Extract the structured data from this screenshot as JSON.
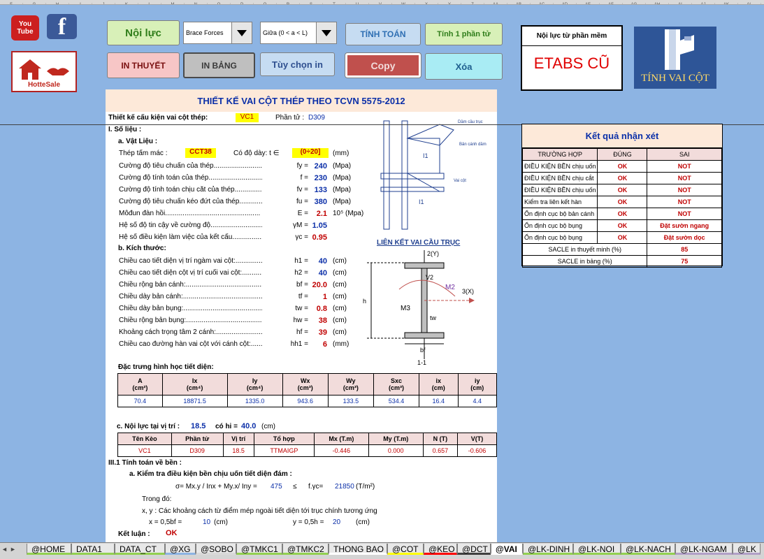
{
  "columns": [
    "F",
    "G",
    "H",
    "I",
    "J",
    "K",
    "L",
    "M",
    "N",
    "O",
    "P",
    "Q",
    "R",
    "S",
    "T",
    "U",
    "V",
    "W",
    "X",
    "Y",
    "Z",
    "AA",
    "AB",
    "AC",
    "AD",
    "AE",
    "AF",
    "AG",
    "AH",
    "AI",
    "AJ",
    "AK",
    "AL"
  ],
  "social": {
    "youtube": "You Tube",
    "facebook": "f",
    "hotte": "HotteSale"
  },
  "toolbar": {
    "noi_luc": "Nội lực",
    "brace": "Brace Forces",
    "position": "Giữa (0 < a < L)",
    "tinh_toan": "TÍNH TOÁN",
    "tinh_1": "Tính 1 phần tử",
    "in_thuyet": "IN THUYẾT",
    "in_bang": "IN BẢNG",
    "tuy_chon": "Tùy chọn in",
    "copy": "Copy",
    "xoa": "Xóa",
    "noi_luc_phan_mem": "Nội lực từ phần mềm",
    "etabs": "ETABS CŨ",
    "tinh_vai_cot": "TÍNH VAI CỘT"
  },
  "colors": {
    "accent_red": "#c00000",
    "value_blue": "#0b2fa8",
    "header_peach": "#fde9d9",
    "input_yellow": "#ffff00"
  },
  "sheet": {
    "title": "THIẾT KẾ VAI CỘT THÉP THEO TCVN 5575-2012",
    "design_label": "Thiết kế cấu kiện vai cột thép:",
    "design_value": "VC1",
    "element_label": "Phần tử :",
    "element_value": "D309",
    "sec1": "I.  Số liệu :",
    "sec_a": "a. Vật Liệu :",
    "steel_label": "Thép tấm mác :",
    "steel_value": "CCT38",
    "thick_label": "Có độ dày:  t ∈",
    "thick_value": "(0÷20]",
    "thick_unit": "(mm)",
    "materials": [
      {
        "label": "Cường độ tiêu chuẩn của thép.............................",
        "sym": "fy =",
        "val": "240",
        "unit": "(Mpa)"
      },
      {
        "label": "Cường độ tính toán của thép..............................",
        "sym": "f =",
        "val": "230",
        "unit": "(Mpa)"
      },
      {
        "label": "Cường độ tính toán chịu cắt của thép.....................",
        "sym": "fv =",
        "val": "133",
        "unit": "(Mpa)"
      },
      {
        "label": "Cường độ tiêu chuẩn kéo đứt của thép...................",
        "sym": "fu =",
        "val": "380",
        "unit": "(Mpa)"
      },
      {
        "label": "Môđun đàn hồi.................................................",
        "sym": "E =",
        "val": "2.1",
        "unit": "10⁵ (Mpa)"
      },
      {
        "label": "Hệ số độ tin cậy về cường độ..............................",
        "sym": "γM =",
        "val": "1.05",
        "unit": ""
      },
      {
        "label": "Hệ số điều kiện làm việc của kết cấu...................",
        "sym": "γc =",
        "val": "0.95",
        "unit": ""
      }
    ],
    "sec_b": "b. Kích thước:",
    "dims": [
      {
        "label": "Chiều cao tiết diện vị trí ngàm vai cột:...................",
        "sym": "h1 =",
        "val": "40",
        "unit": "(cm)"
      },
      {
        "label": "Chiều cao tiết diện cột vị trí cuối vai cột:.................",
        "sym": "h2 =",
        "val": "40",
        "unit": "(cm)"
      },
      {
        "label": "Chiều rộng bản cánh:...............................................",
        "sym": "bf =",
        "val": "20.0",
        "unit": "(cm)"
      },
      {
        "label": "Chiều dày bản cánh:................................................",
        "sym": "tf =",
        "val": "1",
        "unit": "(cm)"
      },
      {
        "label": "Chiều dày bản bụng:...............................................",
        "sym": "tw =",
        "val": "0.8",
        "unit": "(cm)"
      },
      {
        "label": "Chiều rộng bản bụng:..............................................",
        "sym": "hw =",
        "val": "38",
        "unit": "(cm)"
      },
      {
        "label": "Khoảng cách trọng tâm 2 cánh:...............................",
        "sym": "hf =",
        "val": "39",
        "unit": "(cm)"
      },
      {
        "label": "Chiều cao đường hàn vai cột với cánh cột:................",
        "sym": "hh1 =",
        "val": "6",
        "unit": "(mm)"
      }
    ],
    "diagram_title": "LIÊN KẾT VAI CẦU TRỤC",
    "diagram_labels": {
      "dam": "Dầm cầu trục",
      "ban_canh": "Bản cánh dầm",
      "vai": "Vai cột",
      "i1": "I1",
      "i1b": "I1",
      "y": "2(Y)",
      "x": "3(X)",
      "v2": "V2",
      "m2": "M2",
      "m3": "M3",
      "h": "h",
      "bf": "bf",
      "tw": "tw",
      "sec": "1-1"
    },
    "geo_title": "Đặc trưng hình học tiết diện:",
    "geo_headers": [
      [
        "A",
        "(cm²)"
      ],
      [
        "Ix",
        "(cm⁴)"
      ],
      [
        "Iy",
        "(cm⁴)"
      ],
      [
        "Wx",
        "(cm³)"
      ],
      [
        "Wy",
        "(cm³)"
      ],
      [
        "Sxc",
        "(cm³)"
      ],
      [
        "ix",
        "(cm)"
      ],
      [
        "iy",
        "(cm)"
      ]
    ],
    "geo_values": [
      "70.4",
      "18871.5",
      "1335.0",
      "943.6",
      "133.5",
      "534.4",
      "16.4",
      "4.4"
    ],
    "force_title": "c. Nội lực tại vị trí :",
    "force_pos": "18.5",
    "force_hi_label": "có hi =",
    "force_hi": "40.0",
    "force_unit": "(cm)",
    "force_headers": [
      "Tên Kèo",
      "Phần tử",
      "Vị trí",
      "Tổ hợp",
      "Mx (T.m)",
      "My (T.m)",
      "N (T)",
      "V(T)"
    ],
    "force_values": [
      "VC1",
      "D309",
      "18.5",
      "TTMAIGP",
      "-0.446",
      "0.000",
      "0.657",
      "-0.606"
    ],
    "sec3": "III.1  Tính toán về bền :",
    "sec3a": "a.  Kiểm tra điều kiện bền chịu uốn tiết diện đám :",
    "formula": "σ= Mx.y / Inx + My.x/ Iny  =",
    "formula_val": "475",
    "formula_le": "≤",
    "formula_rhs": "f.γc=",
    "formula_rhs_val": "21850",
    "formula_unit": "(T/m²)",
    "trong_do": "Trong đó:",
    "xy_desc": "x, y : Các khoảng cách từ điểm mép ngoài tiết diện tới trục chính tương ứng",
    "x_label": "x  = 0,5bf =",
    "x_val": "10",
    "x_unit": "(cm)",
    "y_label": "y  = 0,5h =",
    "y_val": "20",
    "y_unit": "(cm)",
    "ketluan_label": "Kết luận :",
    "ketluan_val": "OK"
  },
  "results": {
    "title": "Kết quả nhận xét",
    "headers": [
      "TRƯỜNG HỢP",
      "ĐÚNG",
      "SAI"
    ],
    "rows": [
      [
        "ĐIỀU KIỆN BỀN chịu uốn",
        "OK",
        "NOT"
      ],
      [
        "ĐIỀU KIỆN BỀN chịu cắt",
        "OK",
        "NOT"
      ],
      [
        "ĐIỀU KIỆN BỀN chịu uốn cắt",
        "OK",
        "NOT"
      ],
      [
        "Kiểm tra liên kết hàn",
        "OK",
        "NOT"
      ],
      [
        "Ổn định cục bộ bản cánh",
        "OK",
        "NOT"
      ],
      [
        "Ổn định cục bộ bụng",
        "OK",
        "Đặt sườn ngang"
      ],
      [
        "Ổn định cục bộ bụng",
        "OK",
        "Đặt sườn dọc"
      ]
    ],
    "scale_rows": [
      [
        "SACLE in thuyết minh (%)",
        "85"
      ],
      [
        "SACLE in bảng (%)",
        "75"
      ]
    ]
  },
  "tabs": [
    "@HOME",
    "DATA1",
    "DATA_CT",
    "@XG",
    "@SOBO",
    "@TMKC1",
    "@TMKC2",
    "THONG BAO",
    "@COT",
    "@KEO",
    "@DCT",
    "@VAI",
    "@LK-DINH",
    "@LK-NOI",
    "@LK-NACH",
    "@LK-NGAM",
    "@LK"
  ],
  "tab_active": "@VAI"
}
